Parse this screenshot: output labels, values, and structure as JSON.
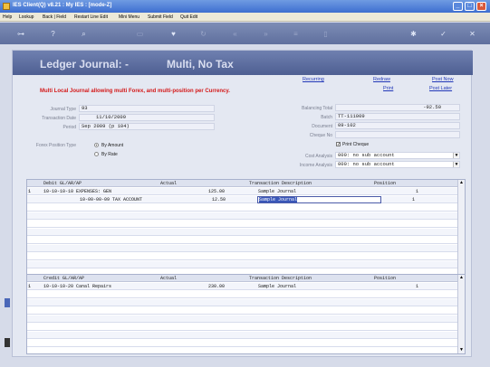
{
  "window": {
    "title": "IES Client(Q) v8.21 : My IES :     [mode-Z]"
  },
  "menu": [
    "Help",
    "Lookup",
    "Back | Field",
    "Restart Line Edit",
    "Mini Menu",
    "Submit Field",
    "Quit Edit"
  ],
  "header": {
    "title": "Ledger Journal: -",
    "subtitle": "Multi, No Tax"
  },
  "links": {
    "recurring": "Recurring",
    "redraw": "Redraw",
    "post_now": "Post Now",
    "print": "Print",
    "post_later": "Post Later"
  },
  "warning": "Multi Local Journal allowing multi Forex, and multi-position per Currency.",
  "form": {
    "journal_type_label": "Journal Type",
    "journal_type_value": "93",
    "transaction_date_label": "Transaction Date",
    "transaction_date_value": "11/10/2009",
    "period_label": "Period",
    "period_value": "Sep 2009 (p 104)",
    "balancing_total_label": "Balancing Total",
    "balancing_total_value": "-92.50",
    "batch_label": "Batch",
    "batch_value": "TT-111009",
    "document_label": "Document",
    "document_value": "09-102",
    "cheque_no_label": "Cheque No",
    "cheque_no_value": "",
    "forex_position_label": "Forex Position Type",
    "opt_amount": "By Amount",
    "opt_rate": "By Rate",
    "print_cheque": "Print Cheque",
    "cost_analysis_label": "Cost Analysis",
    "cost_analysis_value": "000: no sub account",
    "income_analysis_label": "Income Analysis",
    "income_analysis_value": "000: no sub account"
  },
  "debit_grid": {
    "columns": [
      "Debit GL/AR/AP",
      "Actual",
      "Transaction Description",
      "Position"
    ],
    "rows": [
      {
        "num": "1",
        "account": "10-10-10-10 EXPENSES: GEN",
        "actual": "125.00",
        "desc": "Sample Journal",
        "position": "1"
      },
      {
        "num": "",
        "account": "10-00-00-09 TAX ACCOUNT",
        "actual": "12.50",
        "desc": "Sample Journal",
        "position": "1"
      }
    ]
  },
  "tabs": [
    "Nav",
    "Pre",
    "Add",
    "Inc",
    "Ed",
    "Del"
  ],
  "credit_grid": {
    "columns": [
      "Credit GL/AR/AP",
      "Actual",
      "Transaction Description",
      "Position"
    ],
    "rows": [
      {
        "num": "1",
        "account": "10-10-10-20 Canal Repairs",
        "actual": "230.00",
        "desc": "Sample Journal",
        "position": "1"
      }
    ]
  }
}
